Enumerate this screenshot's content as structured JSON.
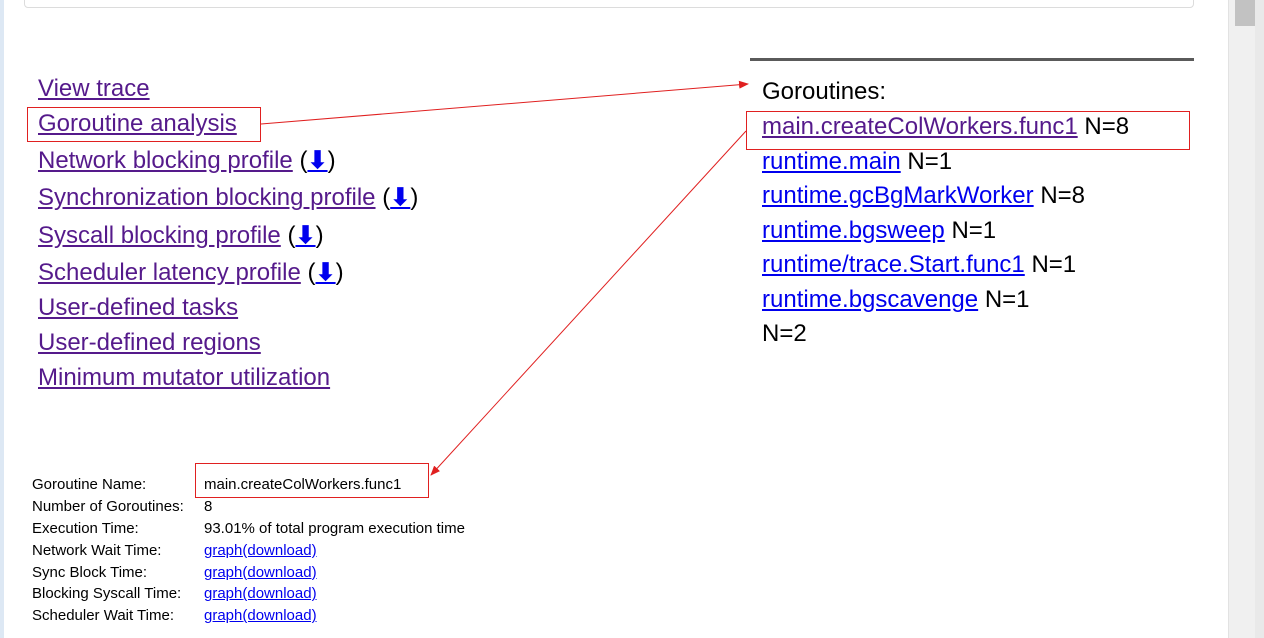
{
  "nav": {
    "items": [
      {
        "label": "View trace"
      },
      {
        "label": "Goroutine analysis"
      },
      {
        "label": "Network blocking profile",
        "download": "⬇"
      },
      {
        "label": "Synchronization blocking profile",
        "download": "⬇"
      },
      {
        "label": "Syscall blocking profile",
        "download": "⬇"
      },
      {
        "label": "Scheduler latency profile",
        "download": "⬇"
      },
      {
        "label": "User-defined tasks"
      },
      {
        "label": "User-defined regions"
      },
      {
        "label": "Minimum mutator utilization"
      }
    ]
  },
  "goroutines": {
    "title": "Goroutines:",
    "rows": [
      {
        "name": "main.createColWorkers.func1",
        "count": "N=8"
      },
      {
        "name": "runtime.main",
        "count": "N=1"
      },
      {
        "name": "runtime.gcBgMarkWorker",
        "count": "N=8"
      },
      {
        "name": "runtime.bgsweep",
        "count": "N=1"
      },
      {
        "name": "runtime/trace.Start.func1",
        "count": "N=1"
      },
      {
        "name": "runtime.bgscavenge",
        "count": "N=1"
      },
      {
        "name": "",
        "count": "N=2"
      }
    ]
  },
  "detail": {
    "rows": [
      {
        "key": "Goroutine Name:",
        "value": "main.createColWorkers.func1"
      },
      {
        "key": "Number of Goroutines:",
        "value": "8"
      },
      {
        "key": "Execution Time:",
        "value": "93.01% of total program execution time"
      },
      {
        "key": "Network Wait Time:",
        "graph": "graph",
        "download": "(download)"
      },
      {
        "key": "Sync Block Time:",
        "graph": "graph",
        "download": "(download)"
      },
      {
        "key": "Blocking Syscall Time:",
        "graph": "graph",
        "download": "(download)"
      },
      {
        "key": "Scheduler Wait Time:",
        "graph": "graph",
        "download": "(download)"
      }
    ]
  },
  "colors": {
    "visited_link": "#551a8b",
    "link": "#0000ee",
    "annotation_red": "#e02020"
  }
}
